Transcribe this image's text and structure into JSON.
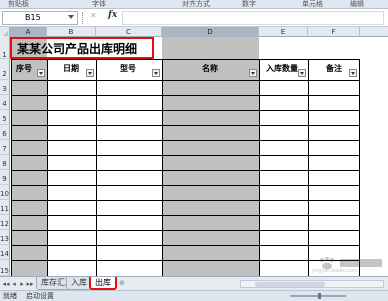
{
  "ribbon": {
    "groups": [
      "剪贴板",
      "字体",
      "对齐方式",
      "数字",
      "单元格",
      "编辑"
    ]
  },
  "formula_bar": {
    "name_box": "B15",
    "fx": "fx",
    "formula": ""
  },
  "columns": [
    "A",
    "B",
    "C",
    "D",
    "E",
    "F"
  ],
  "rows": [
    "1",
    "2",
    "3",
    "4",
    "5",
    "6",
    "7",
    "8",
    "9",
    "10",
    "11",
    "12",
    "13",
    "14",
    "15"
  ],
  "sheet": {
    "title": "某某公司产品出库明细",
    "headers": [
      "序号",
      "日期",
      "型号",
      "名称",
      "入库数量",
      "备注"
    ]
  },
  "tabs": {
    "items": [
      "库存汇总",
      "入库",
      "出库"
    ],
    "active": "出库"
  },
  "status": {
    "ready": "就绪",
    "macro": "启动设置"
  },
  "watermark": {
    "text": "jingyan.baidu.com"
  },
  "icons": {
    "cancel": "✕",
    "tab_nav": [
      "◂◂",
      "◂",
      "▸",
      "▸▸"
    ],
    "add_sheet": "⊕"
  },
  "colors": {
    "highlight": "#e01010",
    "shade": "#c0c0c0",
    "header_bg": "#e4e9f0"
  }
}
